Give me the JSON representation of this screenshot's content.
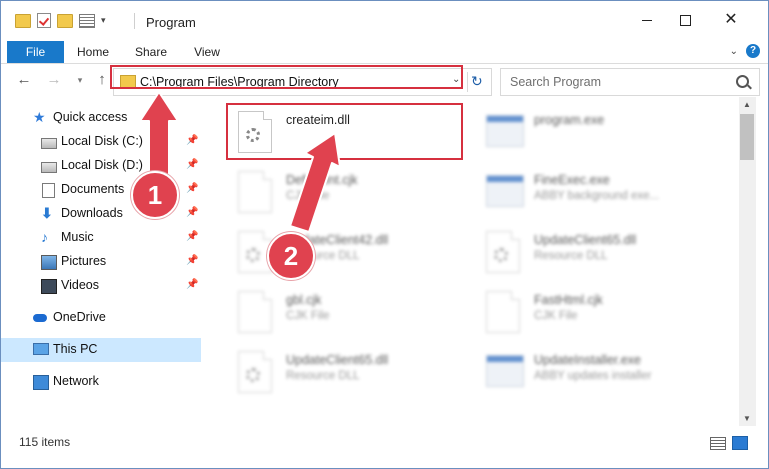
{
  "window": {
    "title": "Program",
    "minimize_icon": "minimize-icon",
    "maximize_icon": "maximize-icon",
    "close_glyph": "✕"
  },
  "ribbon": {
    "tabs": [
      "File",
      "Home",
      "Share",
      "View"
    ],
    "help_label": "?"
  },
  "address": {
    "path": "C:\\Program Files\\Program Directory",
    "search_placeholder": "Search Program"
  },
  "sidebar": {
    "quick_access": "Quick access",
    "items": [
      {
        "label": "Local Disk (C:)",
        "icon": "drive-icon",
        "pinned": true
      },
      {
        "label": "Local Disk (D:)",
        "icon": "drive-icon",
        "pinned": true
      },
      {
        "label": "Documents",
        "icon": "documents-icon",
        "pinned": true
      },
      {
        "label": "Downloads",
        "icon": "downloads-icon",
        "pinned": true
      },
      {
        "label": "Music",
        "icon": "music-icon",
        "pinned": true
      },
      {
        "label": "Pictures",
        "icon": "pictures-icon",
        "pinned": true
      },
      {
        "label": "Videos",
        "icon": "videos-icon",
        "pinned": true
      }
    ],
    "onedrive": "OneDrive",
    "this_pc": "This PC",
    "network": "Network"
  },
  "files": [
    {
      "name": "createim.dll",
      "type": "",
      "icon": "dll-file-icon",
      "blurred": false
    },
    {
      "name": "program.exe",
      "type": "",
      "icon": "exe-file-icon",
      "blurred": true
    },
    {
      "name": "Defaultlnt.cjk",
      "type": "CJK File",
      "icon": "file-icon",
      "blurred": true
    },
    {
      "name": "FineExec.exe",
      "type": "ABBY background exe...",
      "icon": "exe-file-icon",
      "blurred": true
    },
    {
      "name": "UpdateClient42.dll",
      "type": "Resource DLL",
      "icon": "dll-file-icon",
      "blurred": true
    },
    {
      "name": "UpdateClient65.dll",
      "type": "Resource DLL",
      "icon": "dll-file-icon",
      "blurred": true
    },
    {
      "name": "gbl.cjk",
      "type": "CJK File",
      "icon": "file-icon",
      "blurred": true
    },
    {
      "name": "FastHtml.cjk",
      "type": "CJK File",
      "icon": "file-icon",
      "blurred": true
    },
    {
      "name": "UpdateClient65.dll",
      "type": "Resource DLL",
      "icon": "dll-file-icon",
      "blurred": true
    },
    {
      "name": "UpdateInstaller.exe",
      "type": "ABBY updates installer",
      "icon": "exe-file-icon",
      "blurred": true
    }
  ],
  "status": {
    "item_count": "115 items"
  },
  "callouts": {
    "step1": "1",
    "step2": "2",
    "color": "#e0424f"
  }
}
